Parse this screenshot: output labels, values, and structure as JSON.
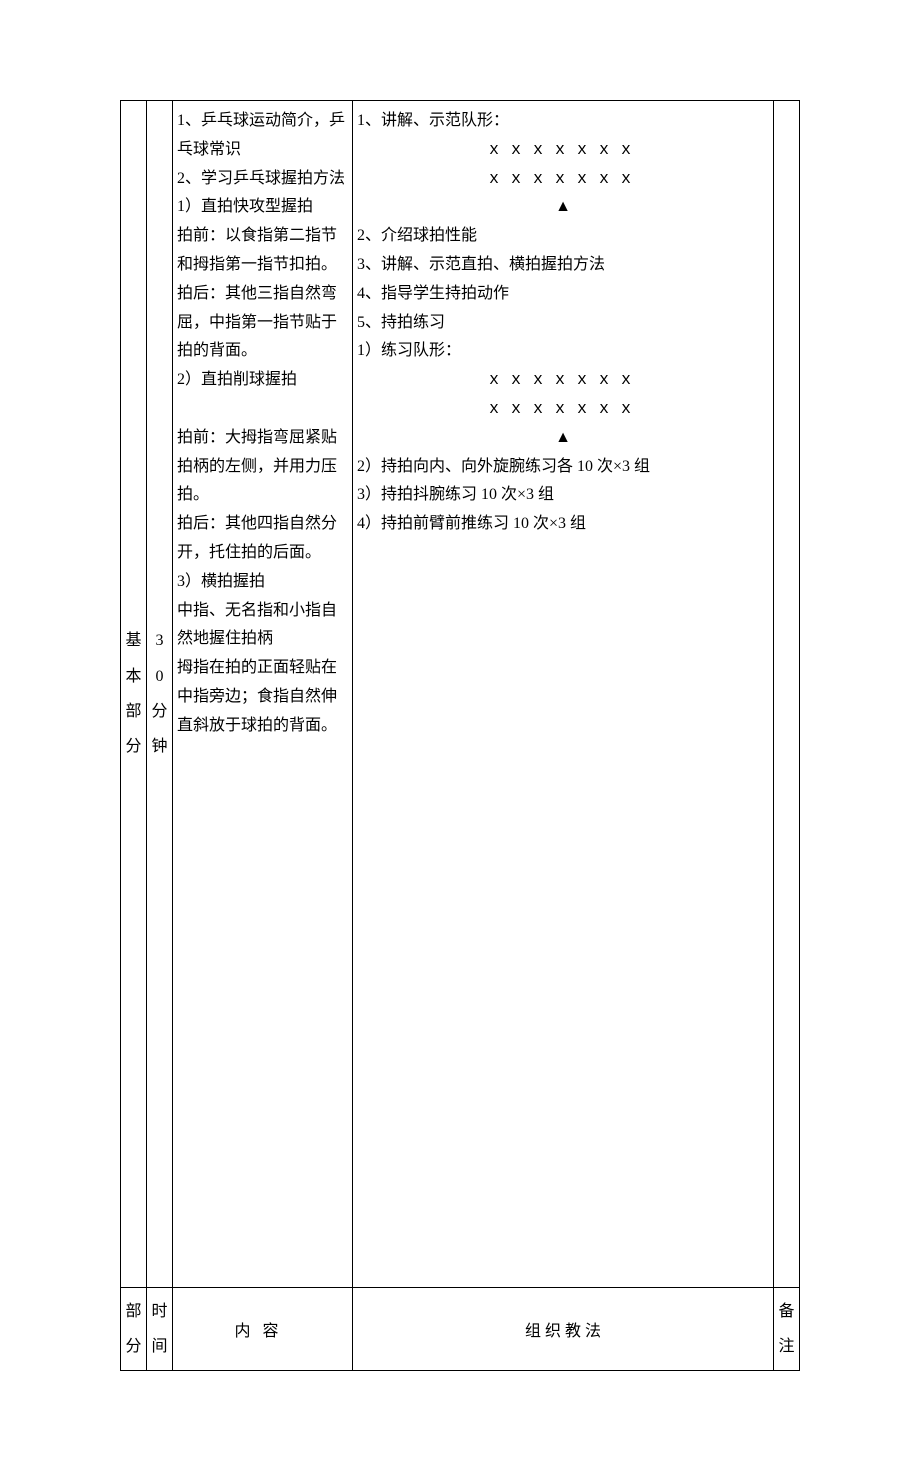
{
  "row1": {
    "section": {
      "c1": "基",
      "c2": "本",
      "c3": "部",
      "c4": "分"
    },
    "time": {
      "c1": "3",
      "c2": "0",
      "c3": "分",
      "c4": "钟"
    },
    "content": {
      "l1": "1、乒乓球运动简介，乒乓球常识",
      "l2": "2、学习乒乓球握拍方法",
      "l3": "1）直拍快攻型握拍",
      "l4": "拍前：以食指第二指节和拇指第一指节扣拍。",
      "l5": "拍后：其他三指自然弯屈，中指第一指节贴于拍的背面。",
      "l6": "2）直拍削球握拍",
      "l7": "拍前：大拇指弯屈紧贴拍柄的左侧，并用力压拍。",
      "l8": "拍后：其他四指自然分开，托住拍的后面。",
      "l9": "3）横拍握拍",
      "l10": "中指、无名指和小指自然地握住拍柄",
      "l11": "拇指在拍的正面轻贴在中指旁边；食指自然伸直斜放于球拍的背面。"
    },
    "method": {
      "l1": "1、讲解、示范队形：",
      "f1a": "ｘｘｘｘｘｘｘ",
      "f1b": "ｘｘｘｘｘｘｘ",
      "f1c": "▲",
      "l2": "2、介绍球拍性能",
      "l3": "3、讲解、示范直拍、横拍握拍方法",
      "l4": "4、指导学生持拍动作",
      "l5": "5、持拍练习",
      "l6": "1）练习队形：",
      "f2a": "ｘｘｘｘｘｘｘ",
      "f2b": "ｘｘｘｘｘｘｘ",
      "f2c": "▲",
      "l7": "2）持拍向内、向外旋腕练习各 10 次×3 组",
      "l8": "3）持拍抖腕练习 10 次×3 组",
      "l9": "4）持拍前臂前推练习 10 次×3 组"
    }
  },
  "row2": {
    "section": {
      "c1": "部",
      "c2": "分"
    },
    "time": {
      "c1": "时",
      "c2": "间"
    },
    "content_header": "内容",
    "method_header": "组 织 教 法",
    "note": {
      "c1": "备",
      "c2": "注"
    }
  }
}
